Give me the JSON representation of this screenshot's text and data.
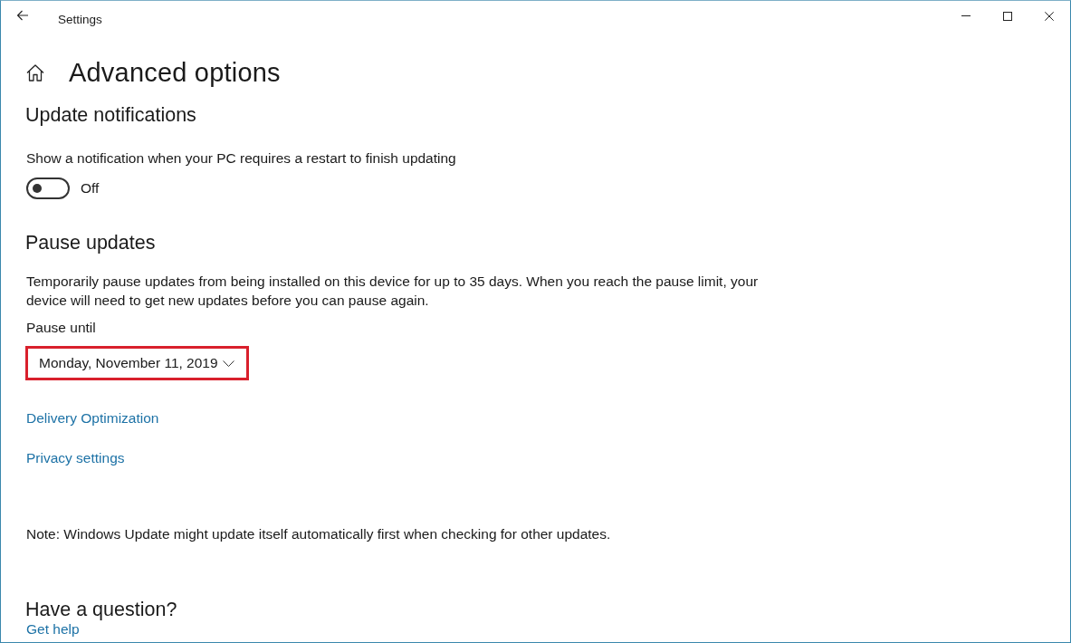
{
  "window": {
    "title": "Settings"
  },
  "page": {
    "title": "Advanced options"
  },
  "notifications": {
    "heading": "Update notifications",
    "label": "Show a notification when your PC requires a restart to finish updating",
    "toggle": {
      "on": false,
      "state_label": "Off"
    }
  },
  "pause": {
    "heading": "Pause updates",
    "description": "Temporarily pause updates from being installed on this device for up to 35 days. When you reach the pause limit, your device will need to get new updates before you can pause again.",
    "field_label": "Pause until",
    "dropdown": {
      "value": "Monday, November 11, 2019",
      "highlighted": true
    }
  },
  "links": [
    "Delivery Optimization",
    "Privacy settings"
  ],
  "note": "Note: Windows Update might update itself automatically first when checking for other updates.",
  "help": {
    "heading": "Have a question?",
    "link": "Get help"
  }
}
